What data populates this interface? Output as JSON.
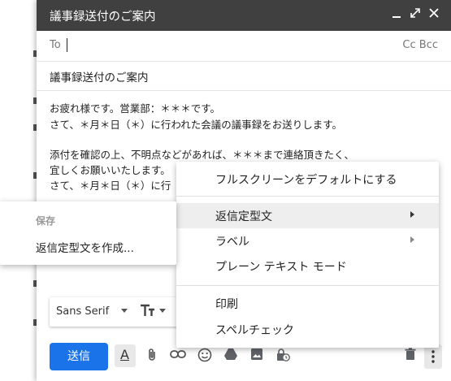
{
  "compose": {
    "title": "議事録送付のご案内",
    "to_label": "To",
    "cc_bcc": "Cc Bcc",
    "subject": "議事録送付のご案内",
    "body_lines": [
      "お疲れ様です。営業部：＊＊＊です。",
      "さて、＊月＊日（＊）に行われた会議の議事録をお送りします。",
      "",
      "添付を確認の上、不明点などがあれば、＊＊＊まで連絡頂きたく、",
      "宜しくお願いいたします。",
      "さて、＊月＊日（＊）に行"
    ]
  },
  "toolbar": {
    "font": "Sans Serif",
    "send_label": "送信"
  },
  "menu": {
    "items": [
      {
        "label": "フルスクリーンをデフォルトにする",
        "submenu": false
      },
      {
        "label": "返信定型文",
        "submenu": true,
        "highlighted": true
      },
      {
        "label": "ラベル",
        "submenu": true
      },
      {
        "label": "プレーン テキスト モード",
        "submenu": false
      },
      {
        "label": "印刷",
        "submenu": false
      },
      {
        "label": "スペルチェック",
        "submenu": false
      }
    ]
  },
  "submenu": {
    "header": "保存",
    "item": "返信定型文を作成..."
  },
  "colors": {
    "titlebar": "#404040",
    "send": "#1a73e8",
    "highlight": "#eeeeee"
  }
}
